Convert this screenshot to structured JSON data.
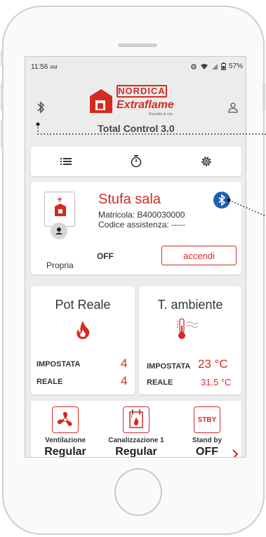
{
  "status_bar": {
    "time": "11:56",
    "ampm": "AM",
    "battery": "57%"
  },
  "header": {
    "brand_top": "NORDICA",
    "brand_bottom": "Extraflame",
    "tagline": "Riscalda la vita.",
    "title": "Total Control 3.0"
  },
  "tabs": [
    "list",
    "timer",
    "settings"
  ],
  "stove": {
    "name": "Stufa sala",
    "matricola": "Matricola: B400030000",
    "codice": "Codice assistenza: -----",
    "owner": "Propria",
    "status": "OFF",
    "action": "accendi"
  },
  "pot": {
    "title": "Pot Reale",
    "set_label": "IMPOSTATA",
    "set_value": "4",
    "real_label": "REALE",
    "real_value": "4"
  },
  "temp": {
    "title": "T. ambiente",
    "set_label": "IMPOSTATA",
    "set_value": "23 °C",
    "real_label": "REALE",
    "real_value": "31.5 °C"
  },
  "modes": [
    {
      "label": "Ventilazione",
      "value": "Regular"
    },
    {
      "label": "Canalizzazione 1",
      "value": "Regular"
    },
    {
      "label": "Stand by",
      "value": "OFF",
      "icon_text": "STBY"
    }
  ],
  "colors": {
    "accent": "#d42b20",
    "bluetooth": "#1e5fb4"
  },
  "icons": [
    "bluetooth-icon",
    "user-icon",
    "list-icon",
    "timer-icon",
    "settings-icon",
    "flame-icon",
    "thermometer-icon",
    "fan-icon",
    "duct-icon",
    "chevron-right-icon"
  ]
}
